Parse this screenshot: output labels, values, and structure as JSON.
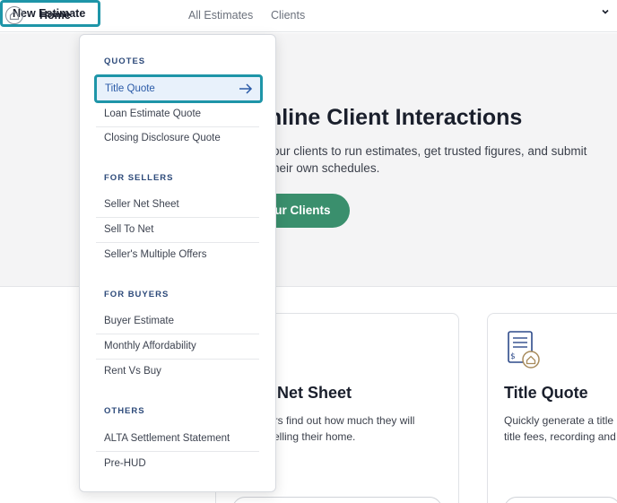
{
  "nav": {
    "home": "Home",
    "new_estimate": "New Estimate",
    "all_estimates": "All Estimates",
    "clients": "Clients"
  },
  "hero": {
    "title": "mline Client Interactions",
    "text_line1": "our clients to run estimates, get trusted figures, and submit",
    "text_line2": "heir own schedules.",
    "button": "our Clients"
  },
  "cards": [
    {
      "title": "Net Sheet",
      "desc_line1": "ers find out how much they will",
      "desc_line2": "selling their home."
    },
    {
      "title": "Title Quote",
      "desc_line1": "Quickly generate a title",
      "desc_line2": "title fees, recording and",
      "icon": "receipt-house-icon"
    }
  ],
  "dropdown": {
    "quotes_label": "QUOTES",
    "quotes": [
      "Title Quote",
      "Loan Estimate Quote",
      "Closing Disclosure Quote"
    ],
    "sellers_label": "FOR SELLERS",
    "sellers": [
      "Seller Net Sheet",
      "Sell To Net",
      "Seller's Multiple Offers"
    ],
    "buyers_label": "FOR BUYERS",
    "buyers": [
      "Buyer Estimate",
      "Monthly Affordability",
      "Rent Vs Buy"
    ],
    "others_label": "OTHERS",
    "others": [
      "ALTA Settlement Statement",
      "Pre-HUD"
    ]
  },
  "colors": {
    "accent_outline": "#1e95a8",
    "primary_button": "#3a8f6d",
    "section_label": "#2d4a7a",
    "active_item_bg": "#e8f1fb"
  }
}
